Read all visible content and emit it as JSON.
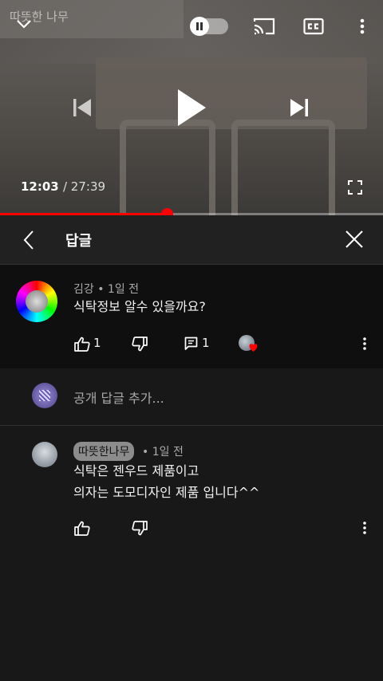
{
  "player": {
    "channel_watermark": "따뜻한 나무",
    "current_time": "12:03",
    "duration": "/ 27:39",
    "progress_fraction": 0.435
  },
  "panel": {
    "title": "답글"
  },
  "parent_comment": {
    "author": "김강",
    "age": "• 1일 전",
    "text": "식탁정보 알수 있을까요?",
    "like_count": "1",
    "reply_count": "1"
  },
  "reply_input": {
    "placeholder": "공개 답글 추가..."
  },
  "reply": {
    "author": "따뜻한나무",
    "age": "• 1일 전",
    "text_line1": "식탁은 젠우드 제품이고",
    "text_line2": "의자는 도모디자인 제품 입니다^^"
  },
  "colors": {
    "progress": "#ff0000",
    "heart": "#ff0000",
    "author_chip": "#8c8c8c"
  }
}
